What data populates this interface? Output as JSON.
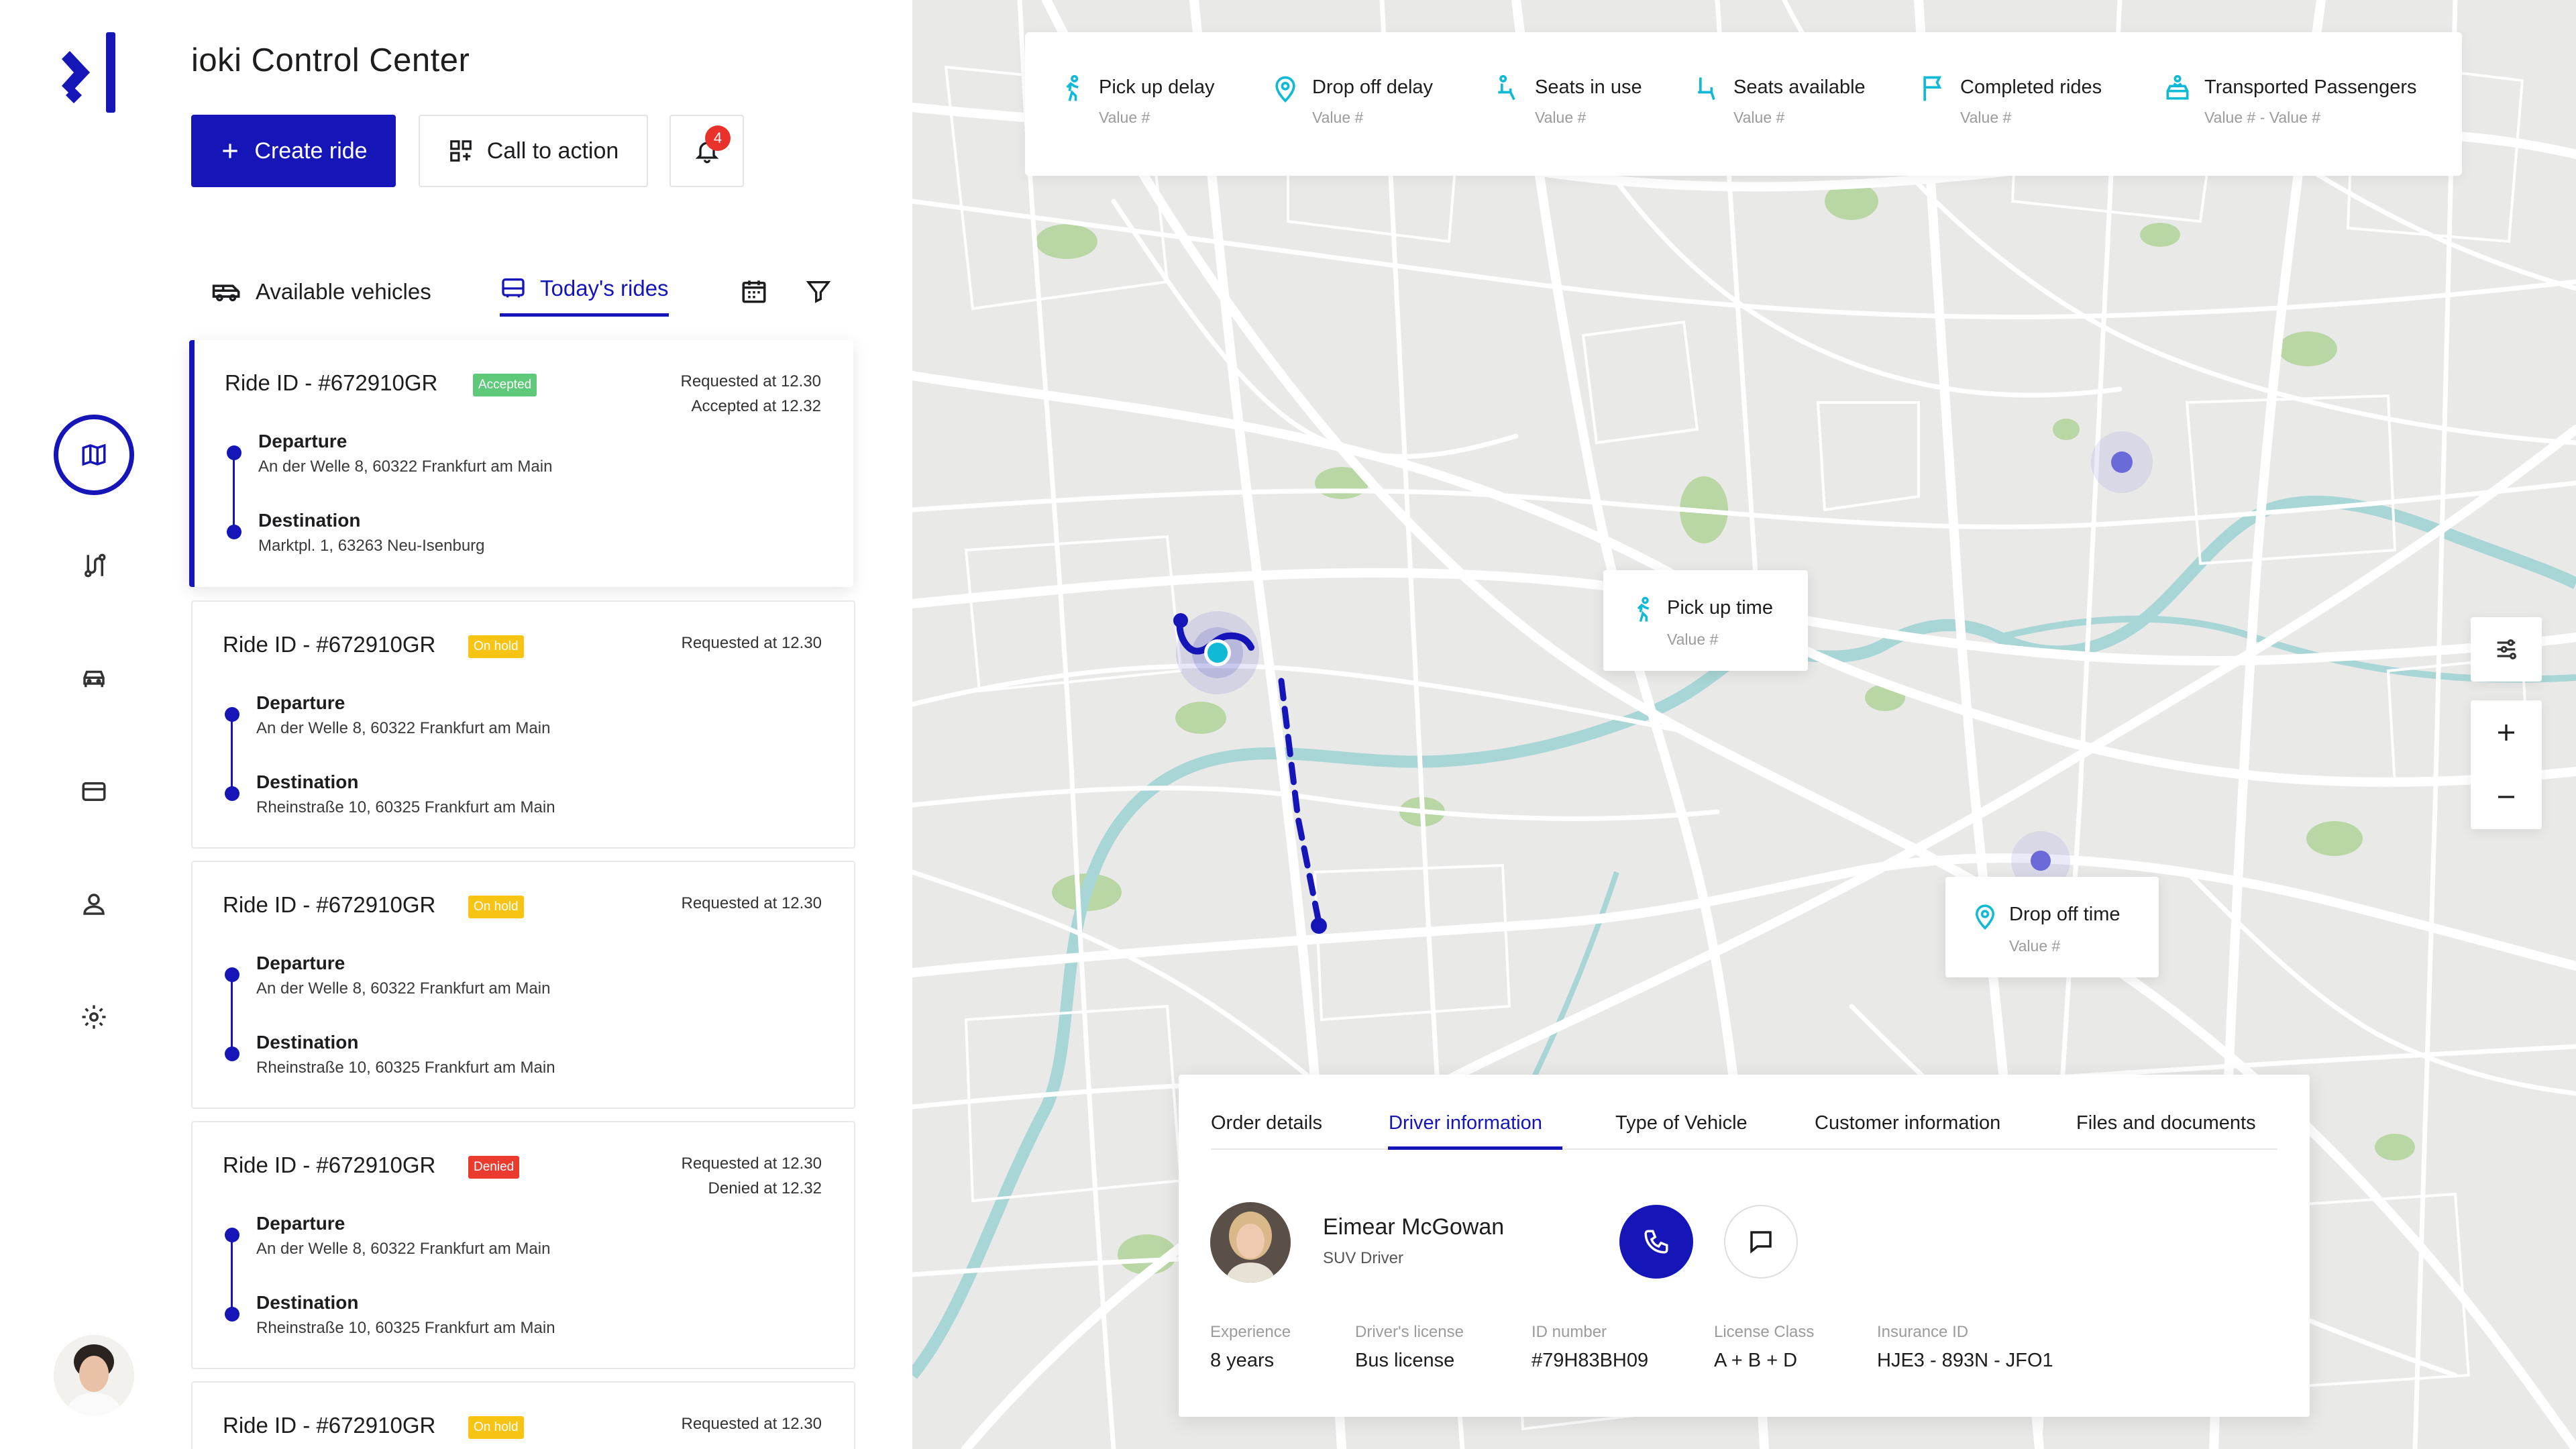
{
  "app": {
    "title": "ioki Control Center"
  },
  "toolbar": {
    "create_label": "Create ride",
    "cta_label": "Call to action",
    "notification_count": "4"
  },
  "tabs": [
    {
      "label": "Available vehicles"
    },
    {
      "label": "Today's rides"
    }
  ],
  "rides": [
    {
      "id": "Ride ID - #672910GR",
      "status": "Accepted",
      "requested": "Requested at 12.30",
      "second": "Accepted at 12.32",
      "departure_label": "Departure",
      "departure": "An der Welle 8, 60322 Frankfurt am Main",
      "destination_label": "Destination",
      "destination": "Marktpl. 1, 63263 Neu-Isenburg"
    },
    {
      "id": "Ride ID - #672910GR",
      "status": "On hold",
      "requested": "Requested at 12.30",
      "second": "",
      "departure_label": "Departure",
      "departure": "An der Welle 8, 60322 Frankfurt am Main",
      "destination_label": "Destination",
      "destination": "Rheinstraße 10, 60325 Frankfurt am Main"
    },
    {
      "id": "Ride ID - #672910GR",
      "status": "On hold",
      "requested": "Requested at 12.30",
      "second": "",
      "departure_label": "Departure",
      "departure": "An der Welle 8, 60322 Frankfurt am Main",
      "destination_label": "Destination",
      "destination": "Rheinstraße 10, 60325 Frankfurt am Main"
    },
    {
      "id": "Ride ID - #672910GR",
      "status": "Denied",
      "requested": "Requested at 12.30",
      "second": "Denied at 12.32",
      "departure_label": "Departure",
      "departure": "An der Welle 8, 60322 Frankfurt am Main",
      "destination_label": "Destination",
      "destination": "Rheinstraße 10, 60325 Frankfurt am Main"
    },
    {
      "id": "Ride ID - #672910GR",
      "status": "On hold",
      "requested": "Requested at 12.30",
      "second": "",
      "departure_label": "",
      "departure": "",
      "destination_label": "",
      "destination": ""
    }
  ],
  "stats": [
    {
      "label": "Pick up delay",
      "value": "Value #",
      "icon": "person-walking-icon"
    },
    {
      "label": "Drop off delay",
      "value": "Value #",
      "icon": "location-pin-icon"
    },
    {
      "label": "Seats in use",
      "value": "Value #",
      "icon": "seated-person-icon"
    },
    {
      "label": "Seats available",
      "value": "Value #",
      "icon": "seat-icon"
    },
    {
      "label": "Completed rides",
      "value": "Value #",
      "icon": "flag-icon"
    },
    {
      "label": "Transported Passengers",
      "value": "Value # - Value #",
      "icon": "car-passenger-icon"
    }
  ],
  "map": {
    "pickup_popup": {
      "label": "Pick up time",
      "value": "Value #"
    },
    "dropoff_popup": {
      "label": "Drop off time",
      "value": "Value #"
    }
  },
  "driver_panel": {
    "tabs": [
      "Order details",
      "Driver information",
      "Type of Vehicle",
      "Customer information",
      "Files and documents"
    ],
    "active_tab": "Driver information",
    "name": "Eimear McGowan",
    "role": "SUV Driver",
    "info": [
      {
        "key": "Experience",
        "value": "8 years"
      },
      {
        "key": "Driver's license",
        "value": "Bus license"
      },
      {
        "key": "ID number",
        "value": "#79H83BH09"
      },
      {
        "key": "License Class",
        "value": "A + B + D"
      },
      {
        "key": "Insurance ID",
        "value": "HJE3 - 893N - JFO1"
      }
    ]
  },
  "colors": {
    "accent": "#1515b8",
    "accepted": "#5fc97a",
    "on_hold": "#f8c414",
    "denied": "#ea3b2e",
    "cyan": "#10b9d6",
    "river": "#a8d6d6",
    "park": "#b9d7a4"
  }
}
